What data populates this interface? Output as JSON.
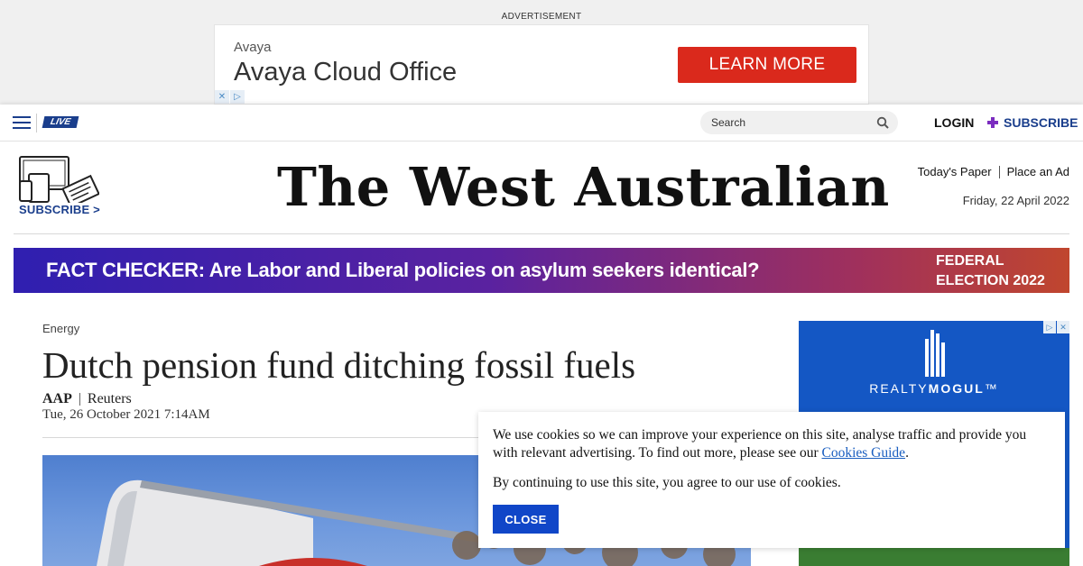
{
  "ad_top": {
    "label": "ADVERTISEMENT",
    "brand": "Avaya",
    "product": "Avaya Cloud Office",
    "cta": "LEARN MORE",
    "cta_color": "#da291c",
    "icons": [
      "close-icon",
      "adchoices-icon"
    ]
  },
  "nav": {
    "live_label": "LIVE",
    "search_placeholder": "Search",
    "login_label": "LOGIN",
    "subscribe_label": "SUBSCRIBE",
    "brand_color": "#1a3e8c"
  },
  "masthead": {
    "subscribe_label": "SUBSCRIBE >",
    "logo_text": "The West Australian",
    "links": [
      "Today's Paper",
      "Place an Ad"
    ],
    "date": "Friday, 22 April 2022"
  },
  "banner": {
    "text": "FACT CHECKER: Are Labor and Liberal policies on asylum seekers identical?",
    "tag_line1": "FEDERAL",
    "tag_line2": "ELECTION 2022"
  },
  "article": {
    "category": "Energy",
    "headline": "Dutch pension fund ditching fossil fuels",
    "author": "AAP",
    "source": "Reuters",
    "published": "Tue, 26 October 2021 7:14AM"
  },
  "side_ad": {
    "brand_prefix": "REALTY",
    "brand_suffix": "MOGUL",
    "tm": "™"
  },
  "cookie": {
    "message": "We use cookies so we can improve your experience on this site, analyse traffic and provide you with relevant advertising. To find out more, please see our ",
    "link_text": "Cookies Guide",
    "message_end": ".",
    "agree_text": "By continuing to use this site, you agree to our use of cookies.",
    "close_label": "CLOSE"
  }
}
